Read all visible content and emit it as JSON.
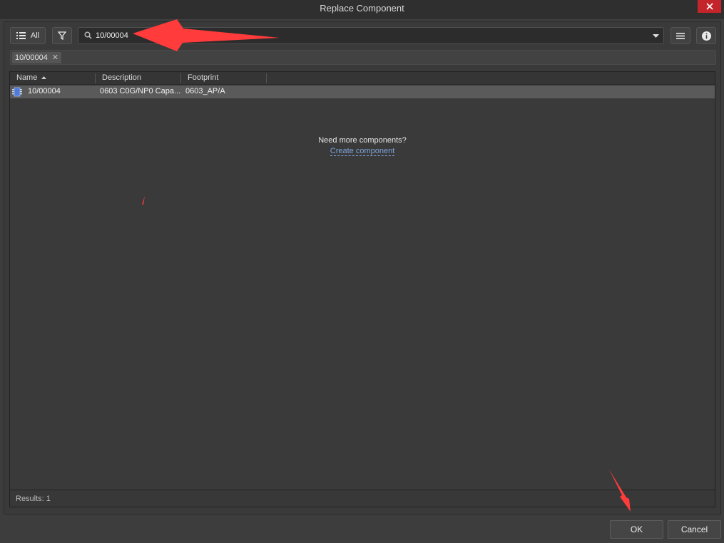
{
  "window": {
    "title": "Replace Component"
  },
  "toolbar": {
    "all_label": "All",
    "search_value": "10/00004"
  },
  "tags": [
    {
      "label": "10/00004"
    }
  ],
  "grid": {
    "columns": [
      "Name",
      "Description",
      "Footprint"
    ],
    "rows": [
      {
        "name": "10/00004",
        "description": "0603 C0G/NP0 Capa...",
        "footprint": "0603_AP/A"
      }
    ],
    "empty_message": "Need more components?",
    "create_link": "Create component",
    "results_label": "Results: 1"
  },
  "footer": {
    "ok_label": "OK",
    "cancel_label": "Cancel"
  },
  "colors": {
    "annotation_arrow": "#ff3b3b",
    "close_button": "#c4252a",
    "link": "#7ea3d9"
  }
}
